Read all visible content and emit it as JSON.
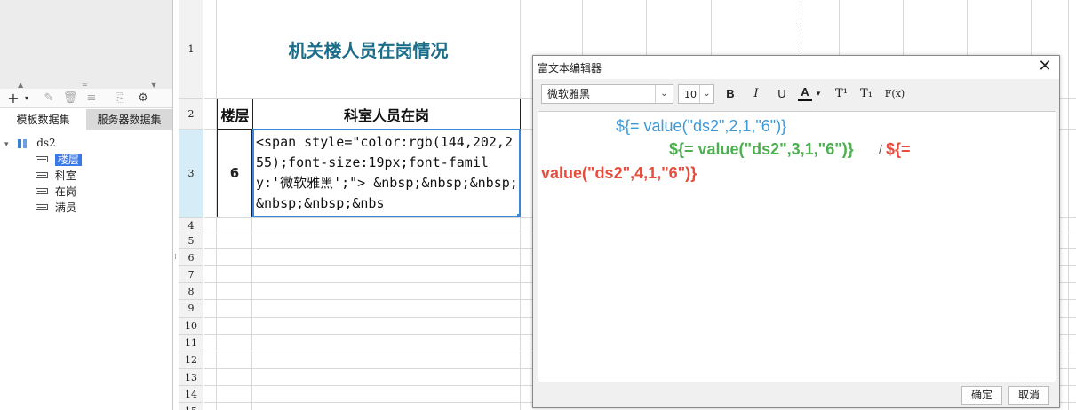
{
  "left_panel": {
    "toolbar_icons": [
      "add-icon",
      "edit-icon",
      "delete-icon",
      "database-icon",
      "preview-icon",
      "settings-icon"
    ],
    "tabs": {
      "template": "模板数据集",
      "server": "服务器数据集"
    },
    "tree": {
      "dataset": "ds2",
      "fields": [
        "楼层",
        "科室",
        "在岗",
        "满员"
      ],
      "selected_field": "楼层"
    }
  },
  "sheet": {
    "row_numbers": [
      "1",
      "2",
      "3",
      "4",
      "5",
      "6",
      "7",
      "8",
      "9",
      "10",
      "11",
      "12",
      "13",
      "14",
      "15"
    ],
    "title": "机关楼人员在岗情况",
    "headers": {
      "floor": "楼层",
      "staff": "科室人员在岗"
    },
    "floor_value": "6",
    "html_cell_text": "<span style=\"color:rgb(144,202,255);font-size:19px;font-family:'微软雅黑';\"> &nbsp;&nbsp;&nbsp;&nbsp;&nbsp;&nbs"
  },
  "dialog": {
    "title": "富文本编辑器",
    "font_family": "微软雅黑",
    "font_size": "10",
    "toolbar": {
      "bold": "B",
      "italic": "I",
      "underline": "U",
      "color": "A",
      "superscript": "T¹",
      "subscript": "T₁",
      "formula": "F(x)"
    },
    "content": {
      "line1": "${= value(\"ds2\",2,1,\"6\")}",
      "line2": "${= value(\"ds2\",3,1,\"6\")}",
      "slash": "/",
      "line2_red": "${=",
      "line3": "value(\"ds2\",4,1,\"6\")}"
    },
    "colors": {
      "blue": "#3a9ad9",
      "green": "#4caf50",
      "red": "#e74c3c"
    },
    "buttons": {
      "ok": "确定",
      "cancel": "取消"
    }
  }
}
